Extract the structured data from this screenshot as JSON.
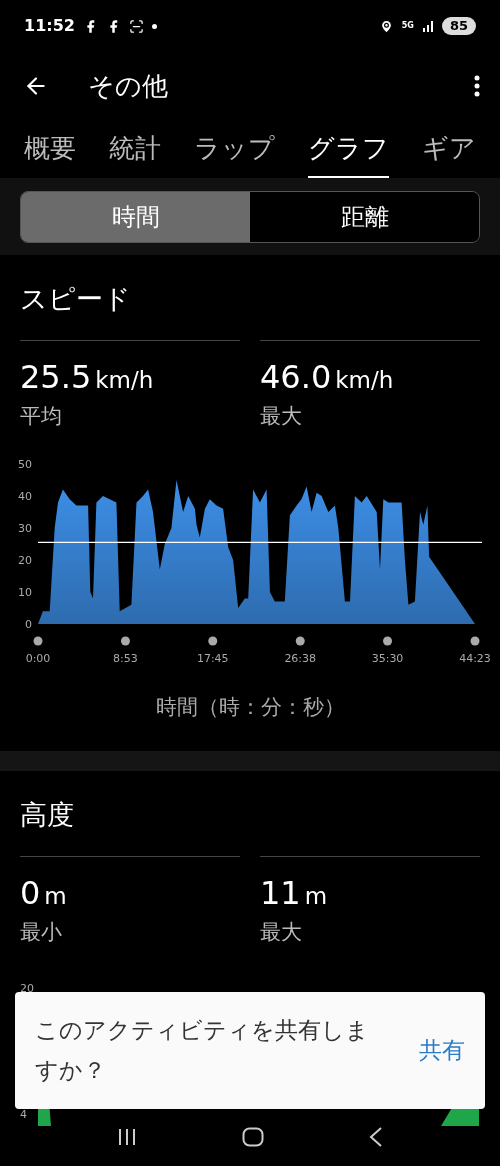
{
  "status_bar": {
    "time": "11:52",
    "network": "5G",
    "battery": "85"
  },
  "app_bar": {
    "title": "その他"
  },
  "tabs": [
    {
      "label": "概要",
      "selected": false
    },
    {
      "label": "統計",
      "selected": false
    },
    {
      "label": "ラップ",
      "selected": false
    },
    {
      "label": "グラフ",
      "selected": true
    },
    {
      "label": "ギア",
      "selected": false
    }
  ],
  "segments": [
    {
      "label": "時間",
      "selected": true
    },
    {
      "label": "距離",
      "selected": false
    }
  ],
  "speed": {
    "title": "スピード",
    "stats": [
      {
        "value": "25.5",
        "unit": "km/h",
        "label": "平均"
      },
      {
        "value": "46.0",
        "unit": "km/h",
        "label": "最大"
      }
    ],
    "chart_data": {
      "type": "area",
      "xlabel": "時間（時：分：秒）",
      "xlim": [
        0,
        2663
      ],
      "ylim": [
        0,
        50
      ],
      "yticks": [
        0,
        10,
        20,
        30,
        40,
        50
      ],
      "xticks": [
        {
          "value": 0,
          "label": "0:00"
        },
        {
          "value": 533,
          "label": "8:53"
        },
        {
          "value": 1065,
          "label": "17:45"
        },
        {
          "value": 1598,
          "label": "26:38"
        },
        {
          "value": 2130,
          "label": "35:30"
        },
        {
          "value": 2663,
          "label": "44:23"
        }
      ],
      "x": [
        0,
        30,
        71,
        102,
        122,
        152,
        193,
        234,
        274,
        305,
        319,
        335,
        356,
        396,
        437,
        478,
        498,
        569,
        600,
        640,
        671,
        701,
        742,
        773,
        813,
        844,
        884,
        915,
        956,
        966,
        986,
        1017,
        1047,
        1088,
        1128,
        1159,
        1189,
        1220,
        1260,
        1281,
        1311,
        1352,
        1393,
        1413,
        1443,
        1504,
        1535,
        1576,
        1606,
        1637,
        1667,
        1698,
        1728,
        1769,
        1809,
        1830,
        1870,
        1901,
        1931,
        1972,
        2003,
        2064,
        2084,
        2104,
        2135,
        2175,
        2216,
        2236,
        2257,
        2297,
        2328,
        2348,
        2373,
        2383,
        2663
      ],
      "series": [
        {
          "color": "#3d8fe8",
          "values": [
            0,
            4,
            4,
            30,
            38,
            42,
            39,
            37,
            37,
            37,
            10,
            8,
            38,
            40,
            39,
            38,
            4,
            6,
            38,
            40,
            42,
            35,
            17,
            25,
            30,
            45,
            35,
            40,
            36,
            31,
            27,
            36,
            39,
            37,
            36,
            24,
            20,
            5,
            8,
            8,
            42,
            38,
            42,
            10,
            7,
            7,
            34,
            37,
            39,
            43,
            35,
            41,
            40,
            35,
            37,
            30,
            7,
            7,
            40,
            38,
            40,
            35,
            17,
            39,
            38,
            38,
            38,
            20,
            6,
            7,
            35,
            31,
            37,
            21,
            0
          ]
        }
      ],
      "ref_lines": [
        {
          "axis": "y",
          "value": 25.5
        }
      ]
    }
  },
  "altitude": {
    "title": "高度",
    "stats": [
      {
        "value": "0",
        "unit": "m",
        "label": "最小"
      },
      {
        "value": "11",
        "unit": "m",
        "label": "最大"
      }
    ],
    "chart_tick_labels": [
      "20",
      "4"
    ]
  },
  "toast": {
    "message": "このアクティビティを共有しますか？",
    "action": "共有"
  }
}
